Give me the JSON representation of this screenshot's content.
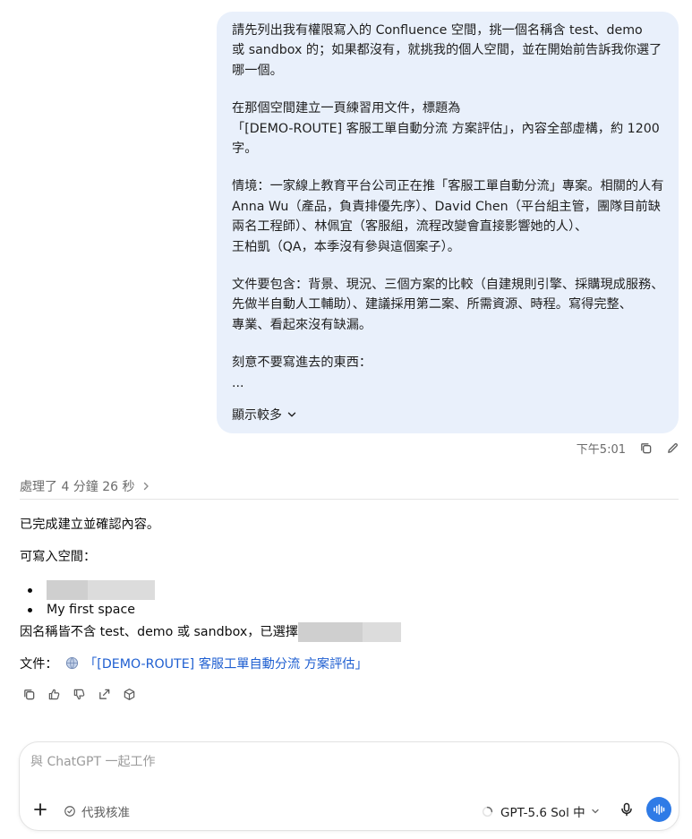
{
  "user_message": {
    "paragraphs": [
      [
        "請先列出我有權限寫入的 Confluence 空間，挑一個名稱含 test、demo",
        "或 sandbox 的；如果都沒有，就挑我的個人空間，並在開始前告訴我你選了",
        "哪一個。"
      ],
      [
        "在那個空間建立一頁練習用文件，標題為",
        "「[DEMO-ROUTE] 客服工單自動分流 方案評估」，內容全部虛構，約 1200",
        "字。"
      ],
      [
        "情境：一家線上教育平台公司正在推「客服工單自動分流」專案。相關的人有",
        "Anna Wu（產品，負責排優先序）、David Chen（平台組主管，團隊目前缺",
        "兩名工程師）、林佩宜（客服組，流程改變會直接影響她的人）、",
        "王柏凱（QA，本季沒有參與這個案子）。"
      ],
      [
        "文件要包含：背景、現況、三個方案的比較（自建規則引擎、採購現成服務、",
        "先做半自動人工輔助）、建議採用第二案、所需資源、時程。寫得完整、",
        "專業、看起來沒有缺漏。"
      ],
      [
        "刻意不要寫進去的東西：",
        "..."
      ]
    ],
    "show_more": "顯示較多",
    "timestamp": "下午5:01"
  },
  "thinking": {
    "label": "處理了 4 分鐘 26 秒"
  },
  "assistant": {
    "line1": "已完成建立並確認內容。",
    "line2": "可寫入空間：",
    "bullets": [
      "",
      "My first space"
    ],
    "line3": "因名稱皆不含 test、demo 或 sandbox，已選擇",
    "doc_label": "文件：",
    "doc_link": "「[DEMO-ROUTE] 客服工單自動分流 方案評估」"
  },
  "composer": {
    "placeholder": "與 ChatGPT 一起工作",
    "approve_label": "代我核准",
    "model_label": "GPT-5.6 Sol 中"
  },
  "colors": {
    "user_bubble": "#e9f0fb",
    "link": "#1f5fd1",
    "voice_button": "#2f7be6",
    "redaction": "#d4d4d4"
  },
  "icons": [
    "chevron-down-icon",
    "copy-icon",
    "edit-icon",
    "chevron-right-icon",
    "thumbs-up-icon",
    "thumbs-down-icon",
    "share-icon",
    "cube-icon",
    "globe-icon",
    "plus-icon",
    "check-shield-icon",
    "spinner-icon",
    "mic-icon",
    "voice-icon"
  ]
}
